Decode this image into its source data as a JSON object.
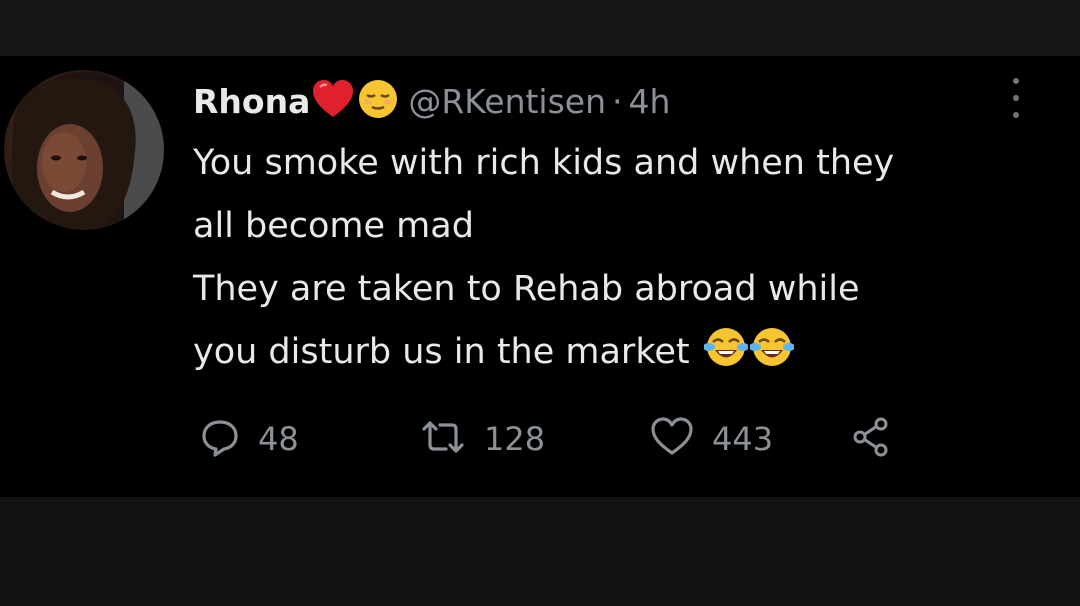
{
  "tweet": {
    "author": {
      "display_name": "Rhona",
      "name_emojis": [
        "red-heart-emoji",
        "relieved-face-emoji"
      ],
      "handle": "@RKentisen",
      "separator": "·",
      "time": "4h"
    },
    "text_lines": [
      "You smoke with rich kids and when they",
      "all become mad",
      "They are taken to Rehab abroad while",
      "you disturb us in the market"
    ],
    "text_emojis": [
      "face-with-tears-of-joy-emoji",
      "face-with-tears-of-joy-emoji"
    ],
    "actions": {
      "replies": "48",
      "retweets": "128",
      "likes": "443"
    }
  },
  "icons": {
    "more": "more-vertical-icon",
    "reply": "reply-icon",
    "retweet": "retweet-icon",
    "like": "heart-icon",
    "share": "share-icon"
  },
  "colors": {
    "background": "#000000",
    "text_primary": "#e7e9ea",
    "text_secondary": "#8b9197",
    "heart": "#e0202c",
    "emoji_yellow": "#f7c531"
  }
}
